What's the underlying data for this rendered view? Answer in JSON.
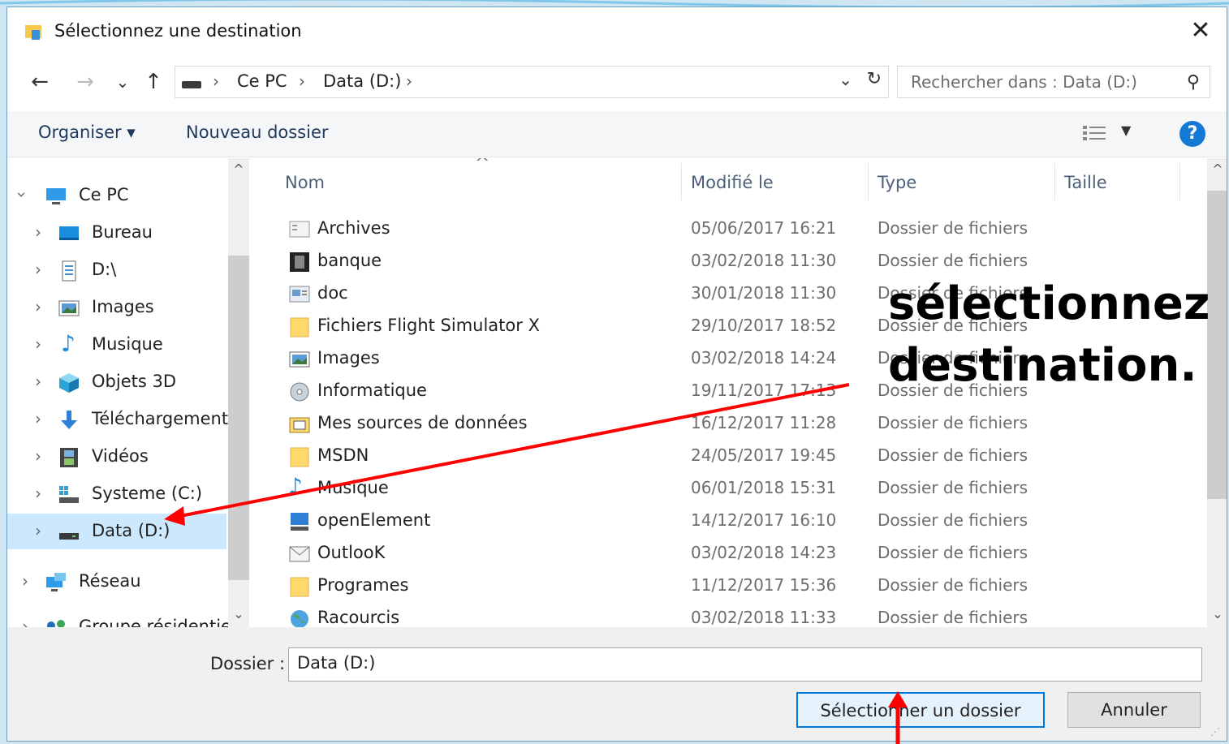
{
  "window": {
    "title": "Sélectionnez une destination",
    "close_glyph": "✕"
  },
  "address": {
    "crumbs": [
      "Ce PC",
      "Data (D:)"
    ],
    "separator": "›",
    "search_placeholder": "Rechercher dans : Data (D:)"
  },
  "nav_buttons": {
    "back": "←",
    "forward": "→",
    "recent": "⌄",
    "up": "↑",
    "dropdown": "⌄",
    "refresh": "↻",
    "search": "⚲"
  },
  "toolbar": {
    "organize": "Organiser ▾",
    "new_folder": "Nouveau dossier",
    "view_dropdown": "▼",
    "help": "?"
  },
  "sidebar": {
    "items": [
      {
        "label": "Ce PC",
        "icon": "computer-icon"
      },
      {
        "label": "Bureau",
        "icon": "desktop-icon"
      },
      {
        "label": "D:\\",
        "icon": "document-icon"
      },
      {
        "label": "Images",
        "icon": "pictures-icon"
      },
      {
        "label": "Musique",
        "icon": "music-icon"
      },
      {
        "label": "Objets 3D",
        "icon": "cube-icon"
      },
      {
        "label": "Téléchargement",
        "icon": "download-icon"
      },
      {
        "label": "Vidéos",
        "icon": "video-icon"
      },
      {
        "label": "Systeme (C:)",
        "icon": "system-drive-icon"
      },
      {
        "label": "Data (D:)",
        "icon": "drive-icon",
        "selected": true
      },
      {
        "label": "Réseau",
        "icon": "network-icon"
      },
      {
        "label": "Groupe résidentie",
        "icon": "homegroup-icon"
      }
    ]
  },
  "columns": {
    "name": "Nom",
    "modified": "Modifié le",
    "type": "Type",
    "size": "Taille"
  },
  "files": [
    {
      "name": "Archives",
      "date": "05/06/2017 16:21",
      "type": "Dossier de fichiers",
      "icon": "archive-folder-icon"
    },
    {
      "name": "banque",
      "date": "03/02/2018 11:30",
      "type": "Dossier de fichiers",
      "icon": "bank-folder-icon"
    },
    {
      "name": "doc",
      "date": "30/01/2018 11:30",
      "type": "Dossier de fichiers",
      "icon": "doc-folder-icon"
    },
    {
      "name": "Fichiers Flight Simulator X",
      "date": "29/10/2017 18:52",
      "type": "Dossier de fichiers",
      "icon": "folder-icon"
    },
    {
      "name": "Images",
      "date": "03/02/2018 14:24",
      "type": "Dossier de fichiers",
      "icon": "pictures-folder-icon"
    },
    {
      "name": "Informatique",
      "date": "19/11/2017 17:13",
      "type": "Dossier de fichiers",
      "icon": "disc-folder-icon"
    },
    {
      "name": "Mes sources de données",
      "date": "16/12/2017 11:28",
      "type": "Dossier de fichiers",
      "icon": "datasource-folder-icon"
    },
    {
      "name": "MSDN",
      "date": "24/05/2017 19:45",
      "type": "Dossier de fichiers",
      "icon": "folder-icon"
    },
    {
      "name": "Musique",
      "date": "06/01/2018 15:31",
      "type": "Dossier de fichiers",
      "icon": "music-folder-icon"
    },
    {
      "name": "openElement",
      "date": "14/12/2017 16:10",
      "type": "Dossier de fichiers",
      "icon": "monitor-folder-icon"
    },
    {
      "name": "OutlooK",
      "date": "03/02/2018 14:23",
      "type": "Dossier de fichiers",
      "icon": "outlook-folder-icon"
    },
    {
      "name": "Programes",
      "date": "11/12/2017 15:36",
      "type": "Dossier de fichiers",
      "icon": "folder-icon"
    },
    {
      "name": "Racourcis",
      "date": "03/02/2018 11:33",
      "type": "Dossier de fichiers",
      "icon": "globe-folder-icon"
    }
  ],
  "footer": {
    "folder_label": "Dossier :",
    "folder_value": "Data (D:)",
    "select_button": "Sélectionner un dossier",
    "cancel_button": "Annuler"
  },
  "annotation": {
    "line1": "sélectionnez",
    "line2": "destination.",
    "color": "#ff0000"
  },
  "colors": {
    "accent": "#0078d7",
    "selection": "#cce8ff",
    "folder": "#ffd86e"
  }
}
